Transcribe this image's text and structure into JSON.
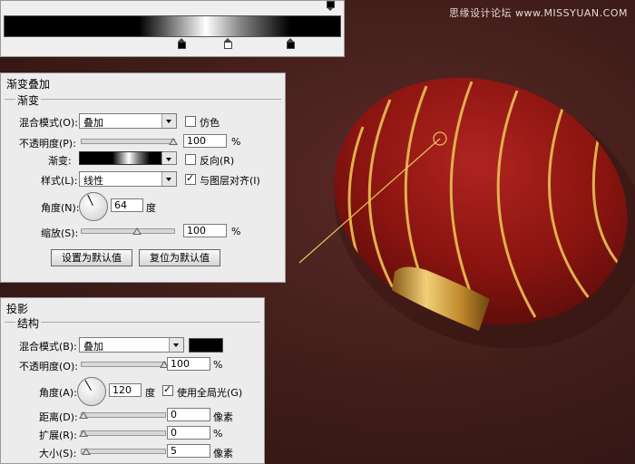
{
  "watermark": "思缘设计论坛  www.MISSYUAN.COM",
  "gradient_overlay": {
    "title": "渐变叠加",
    "group": "渐变",
    "blend_mode_label": "混合模式(O):",
    "blend_mode_value": "叠加",
    "dither_label": "仿色",
    "opacity_label": "不透明度(P):",
    "opacity_value": "100",
    "opacity_unit": "%",
    "opacity_level": 1.0,
    "gradient_label": "渐变:",
    "reverse_label": "反向(R)",
    "style_label": "样式(L):",
    "style_value": "线性",
    "align_label": "与图层对齐(I)",
    "angle_label": "角度(N):",
    "angle_value": "64",
    "angle_unit": "度",
    "scale_label": "缩放(S):",
    "scale_value": "100",
    "scale_unit": "%",
    "scale_level": 0.5,
    "btn_default": "设置为默认值",
    "btn_reset": "复位为默认值"
  },
  "drop_shadow": {
    "title": "投影",
    "group": "结构",
    "blend_mode_label": "混合模式(B):",
    "blend_mode_value": "叠加",
    "color": "#000000",
    "opacity_label": "不透明度(O):",
    "opacity_value": "100",
    "opacity_unit": "%",
    "opacity_level": 1.0,
    "angle_label": "角度(A):",
    "angle_value": "120",
    "angle_unit": "度",
    "global_light_label": "使用全局光(G)",
    "distance_label": "距离(D):",
    "distance_value": "0",
    "distance_unit": "像素",
    "spread_label": "扩展(R):",
    "spread_value": "0",
    "spread_unit": "%",
    "size_label": "大小(S):",
    "size_value": "5",
    "size_unit": "像素"
  },
  "colors": {
    "lantern_red": "#8e1410",
    "gold": "#d4a43c",
    "background": "#3e1c19"
  }
}
